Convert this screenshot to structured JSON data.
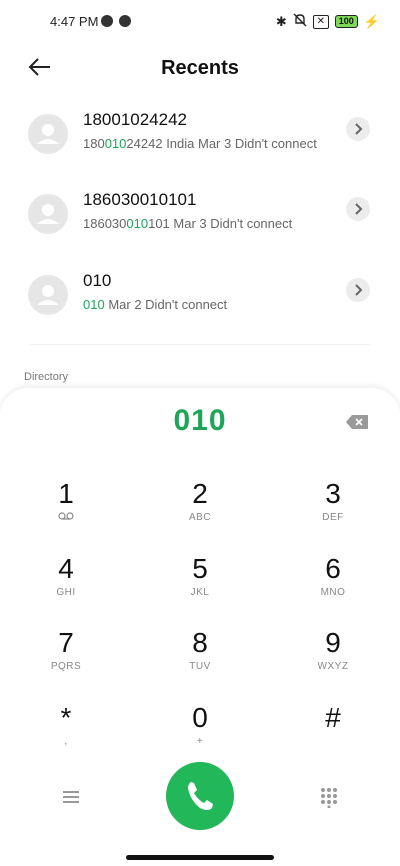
{
  "status": {
    "time": "4:47 PM",
    "battery": "100"
  },
  "header": {
    "title": "Recents"
  },
  "recents": [
    {
      "name": "18001024242",
      "number_pre": "180",
      "number_hl": "010",
      "number_post": "24242",
      "meta": "India  Mar 3 Didn't connect"
    },
    {
      "name": "186030010101",
      "number_pre": "186030",
      "number_hl": "010",
      "number_post": "101",
      "meta": "Mar 3 Didn't connect"
    },
    {
      "name": "010",
      "number_pre": "",
      "number_hl": "010",
      "number_post": "",
      "meta": "Mar 2 Didn't connect"
    }
  ],
  "directory_label": "Directory",
  "dialpad": {
    "typed": "010",
    "keys": [
      {
        "digit": "1",
        "letters": ""
      },
      {
        "digit": "2",
        "letters": "ABC"
      },
      {
        "digit": "3",
        "letters": "DEF"
      },
      {
        "digit": "4",
        "letters": "GHI"
      },
      {
        "digit": "5",
        "letters": "JKL"
      },
      {
        "digit": "6",
        "letters": "MNO"
      },
      {
        "digit": "7",
        "letters": "PQRS"
      },
      {
        "digit": "8",
        "letters": "TUV"
      },
      {
        "digit": "9",
        "letters": "WXYZ"
      },
      {
        "digit": "*",
        "letters": ","
      },
      {
        "digit": "0",
        "letters": "+"
      },
      {
        "digit": "#",
        "letters": ""
      }
    ]
  },
  "icons": {
    "back": "arrow-left-icon",
    "avatar": "person-icon",
    "chevron": "chevron-right-icon",
    "delete": "backspace-icon",
    "call": "phone-icon",
    "menu": "menu-icon",
    "dialpad": "dialpad-icon",
    "voicemail": "voicemail-icon"
  },
  "colors": {
    "accent": "#1ea55a",
    "call": "#22b85a"
  }
}
